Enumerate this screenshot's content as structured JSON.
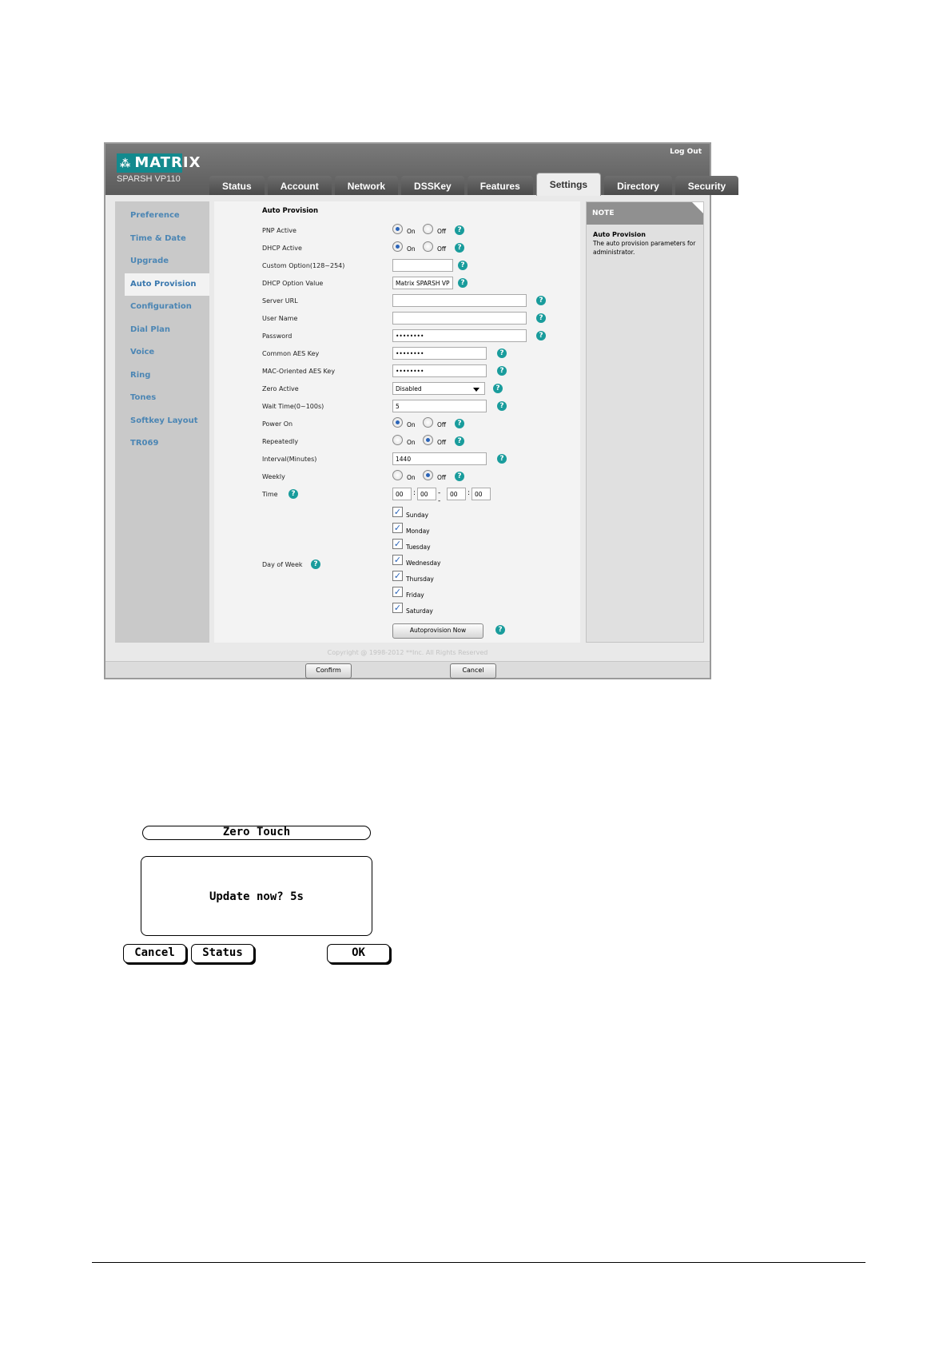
{
  "header": {
    "brand": "MATRIX",
    "model": "SPARSH VP110",
    "logout": "Log Out"
  },
  "tabs": [
    "Status",
    "Account",
    "Network",
    "DSSKey",
    "Features",
    "Settings",
    "Directory",
    "Security"
  ],
  "active_tab": "Settings",
  "sidebar": {
    "items": [
      "Preference",
      "Time & Date",
      "Upgrade",
      "Auto Provision",
      "Configuration",
      "Dial Plan",
      "Voice",
      "Ring",
      "Tones",
      "Softkey Layout",
      "TR069"
    ],
    "active": "Auto Provision"
  },
  "form": {
    "title": "Auto Provision",
    "on_label": "On",
    "off_label": "Off",
    "pnp_active": "PNP Active",
    "dhcp_active": "DHCP Active",
    "custom_option": "Custom Option(128~254)",
    "custom_option_value": "",
    "dhcp_option_value_label": "DHCP Option Value",
    "dhcp_option_value": "Matrix SPARSH VP",
    "server_url": "Server URL",
    "server_url_value": "",
    "user_name": "User Name",
    "user_name_value": "",
    "password": "Password",
    "password_value": "••••••••",
    "common_aes": "Common AES Key",
    "common_aes_value": "••••••••",
    "mac_aes": "MAC-Oriented AES Key",
    "mac_aes_value": "••••••••",
    "zero_active": "Zero Active",
    "zero_active_value": "Disabled",
    "wait_time": "Wait Time(0~100s)",
    "wait_time_value": "5",
    "power_on": "Power On",
    "repeatedly": "Repeatedly",
    "interval": "Interval(Minutes)",
    "interval_value": "1440",
    "weekly": "Weekly",
    "time": "Time",
    "time_values": [
      "00",
      "00",
      "00",
      "00"
    ],
    "time_sep_colon": ":",
    "time_sep_range": "--",
    "day_of_week": "Day of Week",
    "days": [
      "Sunday",
      "Monday",
      "Tuesday",
      "Wednesday",
      "Thursday",
      "Friday",
      "Saturday"
    ],
    "autoprovision_button": "Autoprovision Now"
  },
  "note": {
    "header": "NOTE",
    "title": "Auto Provision",
    "text": "The auto provision parameters for administrator."
  },
  "copyright": "Copyright @ 1998-2012 **Inc. All Rights Reserved",
  "footer_buttons": {
    "confirm": "Confirm",
    "cancel": "Cancel"
  },
  "phone": {
    "title": "Zero Touch",
    "message": "Update now? 5s",
    "softkeys": {
      "cancel": "Cancel",
      "status": "Status",
      "ok": "OK"
    }
  }
}
